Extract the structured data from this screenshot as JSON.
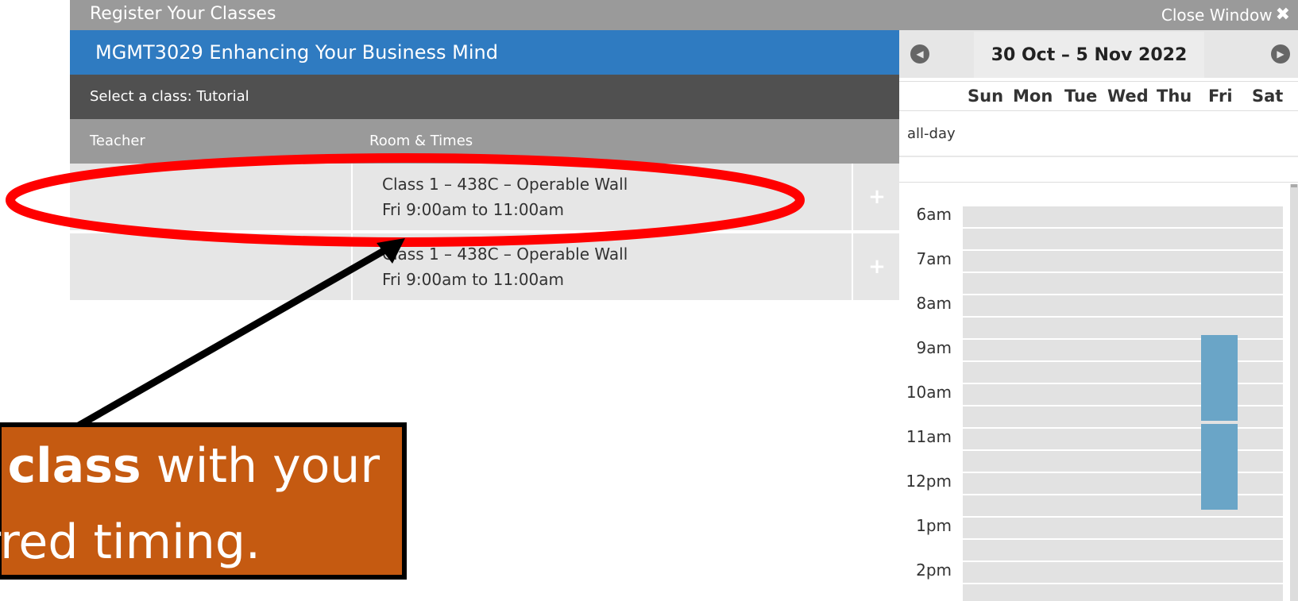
{
  "window": {
    "title": "Register Your Classes",
    "close_label": "Close Window",
    "close_icon": "close-x-icon"
  },
  "course": {
    "title": "MGMT3029 Enhancing Your Business Mind",
    "select_label": "Select a class: Tutorial",
    "columns": [
      "Teacher",
      "Room & Times"
    ],
    "rows": [
      {
        "teacher": "",
        "line1": "Class 1 – 438C – Operable Wall",
        "line2": "Fri 9:00am to 11:00am",
        "add": "+"
      },
      {
        "teacher": "",
        "line1": "Class 1 – 438C – Operable Wall",
        "line2": "Fri 9:00am to 11:00am",
        "add": "+"
      }
    ]
  },
  "calendar": {
    "range": "30 Oct – 5 Nov 2022",
    "prev_icon": "chevron-left-icon",
    "next_icon": "chevron-right-icon",
    "days": [
      "Sun",
      "Mon",
      "Tue",
      "Wed",
      "Thu",
      "Fri",
      "Sat"
    ],
    "allday_label": "all-day",
    "hours": [
      "6am",
      "7am",
      "8am",
      "9am",
      "10am",
      "11am",
      "12pm",
      "1pm",
      "2pm"
    ],
    "events": [
      {
        "day": "Fri",
        "start": "9am",
        "end": "11am"
      },
      {
        "day": "Fri",
        "start": "11am",
        "end": "1pm"
      }
    ],
    "event_color": "#6aa5c7"
  },
  "annotation": {
    "line1_bold": "e class",
    "line1_rest": " with your",
    "line2": "rred timing.",
    "box_color": "#c55a11",
    "ellipse_color": "#ff0000"
  }
}
